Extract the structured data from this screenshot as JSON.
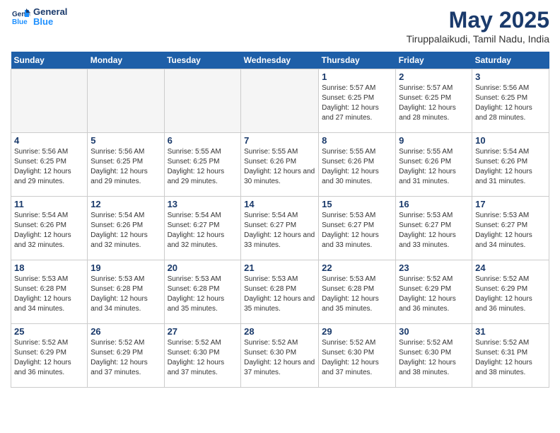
{
  "header": {
    "logo_line1": "General",
    "logo_line2": "Blue",
    "title": "May 2025",
    "subtitle": "Tiruppalaikudi, Tamil Nadu, India"
  },
  "weekdays": [
    "Sunday",
    "Monday",
    "Tuesday",
    "Wednesday",
    "Thursday",
    "Friday",
    "Saturday"
  ],
  "weeks": [
    [
      {
        "day": "",
        "info": ""
      },
      {
        "day": "",
        "info": ""
      },
      {
        "day": "",
        "info": ""
      },
      {
        "day": "",
        "info": ""
      },
      {
        "day": "1",
        "info": "Sunrise: 5:57 AM\nSunset: 6:25 PM\nDaylight: 12 hours\nand 27 minutes."
      },
      {
        "day": "2",
        "info": "Sunrise: 5:57 AM\nSunset: 6:25 PM\nDaylight: 12 hours\nand 28 minutes."
      },
      {
        "day": "3",
        "info": "Sunrise: 5:56 AM\nSunset: 6:25 PM\nDaylight: 12 hours\nand 28 minutes."
      }
    ],
    [
      {
        "day": "4",
        "info": "Sunrise: 5:56 AM\nSunset: 6:25 PM\nDaylight: 12 hours\nand 29 minutes."
      },
      {
        "day": "5",
        "info": "Sunrise: 5:56 AM\nSunset: 6:25 PM\nDaylight: 12 hours\nand 29 minutes."
      },
      {
        "day": "6",
        "info": "Sunrise: 5:55 AM\nSunset: 6:25 PM\nDaylight: 12 hours\nand 29 minutes."
      },
      {
        "day": "7",
        "info": "Sunrise: 5:55 AM\nSunset: 6:26 PM\nDaylight: 12 hours\nand 30 minutes."
      },
      {
        "day": "8",
        "info": "Sunrise: 5:55 AM\nSunset: 6:26 PM\nDaylight: 12 hours\nand 30 minutes."
      },
      {
        "day": "9",
        "info": "Sunrise: 5:55 AM\nSunset: 6:26 PM\nDaylight: 12 hours\nand 31 minutes."
      },
      {
        "day": "10",
        "info": "Sunrise: 5:54 AM\nSunset: 6:26 PM\nDaylight: 12 hours\nand 31 minutes."
      }
    ],
    [
      {
        "day": "11",
        "info": "Sunrise: 5:54 AM\nSunset: 6:26 PM\nDaylight: 12 hours\nand 32 minutes."
      },
      {
        "day": "12",
        "info": "Sunrise: 5:54 AM\nSunset: 6:26 PM\nDaylight: 12 hours\nand 32 minutes."
      },
      {
        "day": "13",
        "info": "Sunrise: 5:54 AM\nSunset: 6:27 PM\nDaylight: 12 hours\nand 32 minutes."
      },
      {
        "day": "14",
        "info": "Sunrise: 5:54 AM\nSunset: 6:27 PM\nDaylight: 12 hours\nand 33 minutes."
      },
      {
        "day": "15",
        "info": "Sunrise: 5:53 AM\nSunset: 6:27 PM\nDaylight: 12 hours\nand 33 minutes."
      },
      {
        "day": "16",
        "info": "Sunrise: 5:53 AM\nSunset: 6:27 PM\nDaylight: 12 hours\nand 33 minutes."
      },
      {
        "day": "17",
        "info": "Sunrise: 5:53 AM\nSunset: 6:27 PM\nDaylight: 12 hours\nand 34 minutes."
      }
    ],
    [
      {
        "day": "18",
        "info": "Sunrise: 5:53 AM\nSunset: 6:28 PM\nDaylight: 12 hours\nand 34 minutes."
      },
      {
        "day": "19",
        "info": "Sunrise: 5:53 AM\nSunset: 6:28 PM\nDaylight: 12 hours\nand 34 minutes."
      },
      {
        "day": "20",
        "info": "Sunrise: 5:53 AM\nSunset: 6:28 PM\nDaylight: 12 hours\nand 35 minutes."
      },
      {
        "day": "21",
        "info": "Sunrise: 5:53 AM\nSunset: 6:28 PM\nDaylight: 12 hours\nand 35 minutes."
      },
      {
        "day": "22",
        "info": "Sunrise: 5:53 AM\nSunset: 6:28 PM\nDaylight: 12 hours\nand 35 minutes."
      },
      {
        "day": "23",
        "info": "Sunrise: 5:52 AM\nSunset: 6:29 PM\nDaylight: 12 hours\nand 36 minutes."
      },
      {
        "day": "24",
        "info": "Sunrise: 5:52 AM\nSunset: 6:29 PM\nDaylight: 12 hours\nand 36 minutes."
      }
    ],
    [
      {
        "day": "25",
        "info": "Sunrise: 5:52 AM\nSunset: 6:29 PM\nDaylight: 12 hours\nand 36 minutes."
      },
      {
        "day": "26",
        "info": "Sunrise: 5:52 AM\nSunset: 6:29 PM\nDaylight: 12 hours\nand 37 minutes."
      },
      {
        "day": "27",
        "info": "Sunrise: 5:52 AM\nSunset: 6:30 PM\nDaylight: 12 hours\nand 37 minutes."
      },
      {
        "day": "28",
        "info": "Sunrise: 5:52 AM\nSunset: 6:30 PM\nDaylight: 12 hours\nand 37 minutes."
      },
      {
        "day": "29",
        "info": "Sunrise: 5:52 AM\nSunset: 6:30 PM\nDaylight: 12 hours\nand 37 minutes."
      },
      {
        "day": "30",
        "info": "Sunrise: 5:52 AM\nSunset: 6:30 PM\nDaylight: 12 hours\nand 38 minutes."
      },
      {
        "day": "31",
        "info": "Sunrise: 5:52 AM\nSunset: 6:31 PM\nDaylight: 12 hours\nand 38 minutes."
      }
    ]
  ]
}
